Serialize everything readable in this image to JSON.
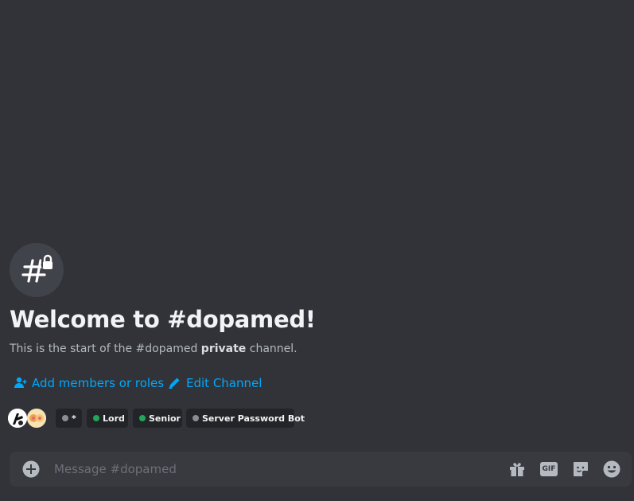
{
  "channel": {
    "name": "dopamed",
    "icon": "hashtag-lock-icon",
    "welcome_title": "Welcome to #dopamed!",
    "subtitle_prefix": "This is the start of the #dopamed ",
    "subtitle_bold": "private",
    "subtitle_suffix": " channel."
  },
  "actions": {
    "add_members_label": "Add members or roles",
    "add_members_icon": "add-person-icon",
    "edit_channel_label": "Edit Channel",
    "edit_channel_icon": "pencil-icon"
  },
  "members": {
    "avatars": [
      {
        "name": "avatar-1",
        "icon": "avatar-icon"
      },
      {
        "name": "avatar-2",
        "icon": "avatar-icon"
      }
    ],
    "roles": [
      {
        "label": "*",
        "color": "#8a8e94"
      },
      {
        "label": "Lord",
        "color": "#23a55a"
      },
      {
        "label": "Senior",
        "color": "#23a55a"
      },
      {
        "label": "Server Password Bot",
        "color": "#8a8e94"
      }
    ]
  },
  "composer": {
    "placeholder": "Message #dopamed",
    "plus_icon": "plus-circle-icon",
    "gift_icon": "gift-icon",
    "gif_label": "GIF",
    "sticker_icon": "sticker-icon",
    "emoji_icon": "emoji-icon"
  },
  "colors": {
    "background": "#313338",
    "link": "#00a8fc",
    "role_pill_bg": "#232428",
    "composer_bg": "#383a40"
  }
}
